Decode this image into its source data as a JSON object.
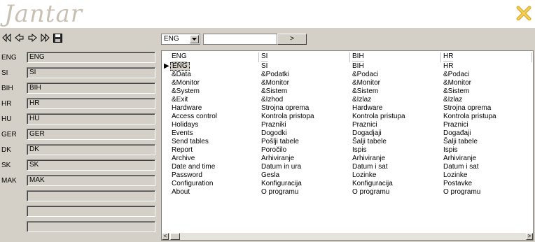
{
  "app": {
    "logo_text": "Jantar",
    "logo_icon": "x-star-icon"
  },
  "toolbar": {
    "buttons": [
      {
        "name": "first-record-button",
        "icon": "skip-back-icon"
      },
      {
        "name": "prev-record-button",
        "icon": "arrow-left-icon"
      },
      {
        "name": "next-record-button",
        "icon": "arrow-right-icon"
      },
      {
        "name": "last-record-button",
        "icon": "skip-forward-icon"
      },
      {
        "name": "save-button",
        "icon": "floppy-disk-icon"
      }
    ]
  },
  "languages": [
    {
      "label": "ENG",
      "value": "ENG"
    },
    {
      "label": "SI",
      "value": "SI"
    },
    {
      "label": "BIH",
      "value": "BIH"
    },
    {
      "label": "HR",
      "value": "HR"
    },
    {
      "label": "HU",
      "value": "HU"
    },
    {
      "label": "GER",
      "value": "GER"
    },
    {
      "label": "DK",
      "value": "DK"
    },
    {
      "label": "SK",
      "value": "SK"
    },
    {
      "label": "MAK",
      "value": "MAK"
    },
    {
      "label": "",
      "value": ""
    },
    {
      "label": "",
      "value": ""
    },
    {
      "label": "",
      "value": ""
    }
  ],
  "search": {
    "combo_value": "ENG",
    "input_value": "",
    "go_label": ">"
  },
  "grid": {
    "columns": [
      "ENG",
      "SI",
      "BIH",
      "HR"
    ],
    "rows": [
      [
        "ENG",
        "SI",
        "BIH",
        "HR"
      ],
      [
        "&Data",
        "&Podatki",
        "&Podaci",
        "&Podaci"
      ],
      [
        "&Monitor",
        "&Monitor",
        "&Monitor",
        "&Monitor"
      ],
      [
        "&System",
        "&Sistem",
        "&Sistem",
        "&Sistem"
      ],
      [
        "&Exit",
        "&Izhod",
        "&Izlaz",
        "&Izlaz"
      ],
      [
        "Hardware",
        "Strojna oprema",
        "Hardware",
        "Strojna oprema"
      ],
      [
        "Access control",
        "Kontrola pristopa",
        "Kontrola pristupa",
        "Kontrola pristupa"
      ],
      [
        "Holidays",
        "Prazniki",
        "Praznici",
        "Praznici"
      ],
      [
        "Events",
        "Dogodki",
        "Dogadjaji",
        "Događaji"
      ],
      [
        "Send tables",
        "Pošlji tabele",
        "Šalji tabele",
        "Šalji tabele"
      ],
      [
        "Report",
        "Poročilo",
        "Ispis",
        "Ispis"
      ],
      [
        "Archive",
        "Arhiviranje",
        "Arhiviranje",
        "Arhiviranje"
      ],
      [
        "Date and time",
        "Datum in ura",
        "Datum i sat",
        "Datum i sat"
      ],
      [
        "Password",
        "Gesla",
        "Lozinke",
        "Lozinke"
      ],
      [
        "Configuration",
        "Konfiguracija",
        "Konfiguracija",
        "Postavke"
      ],
      [
        "About",
        "O programu",
        "O programu",
        "O programu"
      ]
    ],
    "selected_row": 0,
    "row_indicator": "▶"
  },
  "scrollbar": {
    "left_arrow": "<",
    "right_arrow": ">"
  }
}
